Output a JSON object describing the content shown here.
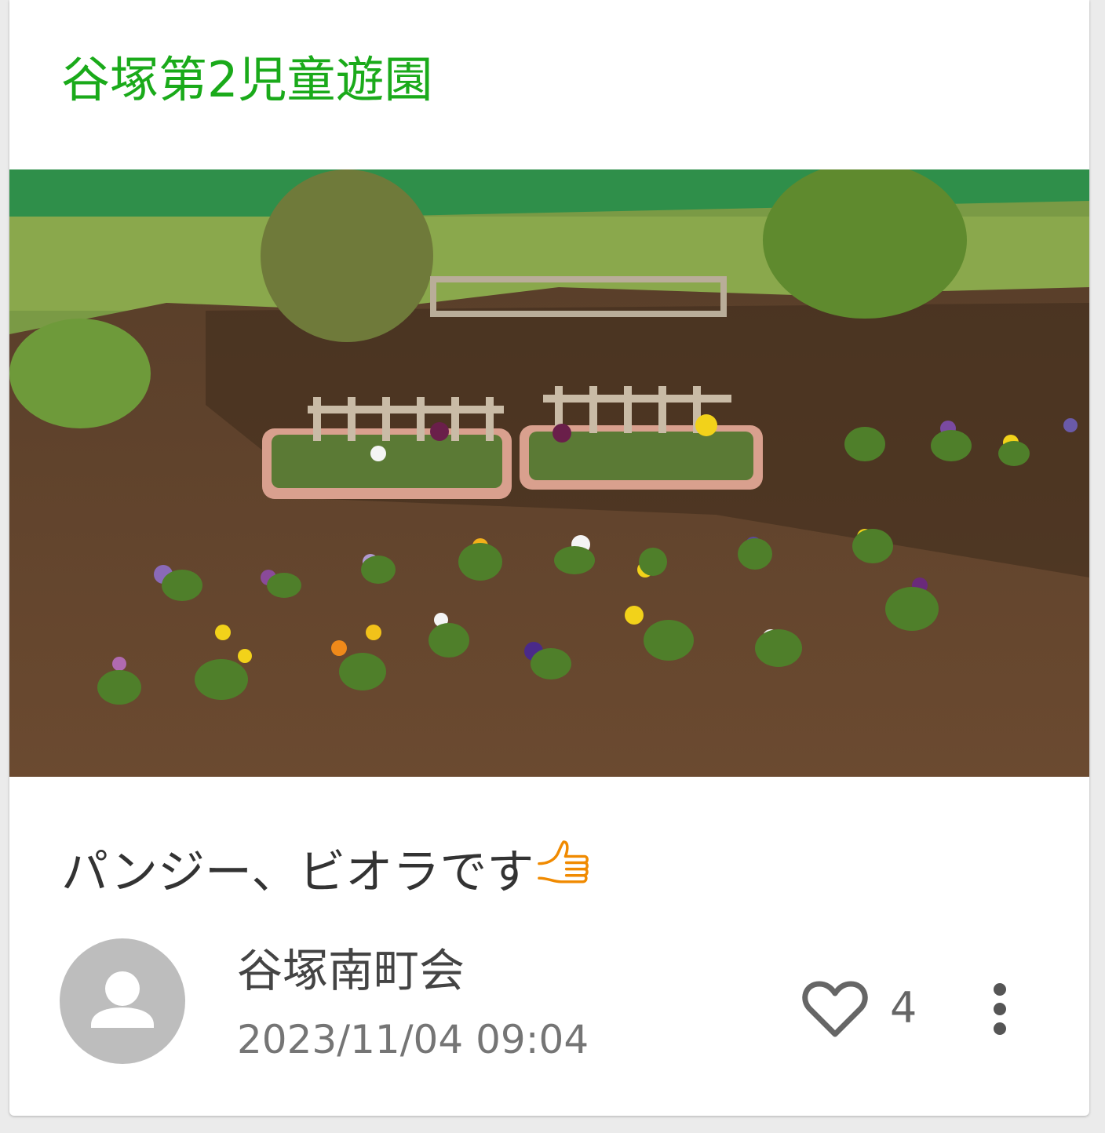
{
  "post": {
    "place_name": "谷塚第2児童遊園",
    "text": "パンジー、ビオラです",
    "text_emoji_icon": "thumbs-up-icon",
    "author": "谷塚南町会",
    "timestamp": "2023/11/04 09:04",
    "like_count": "4"
  },
  "colors": {
    "title_green": "#1aaa1a",
    "emoji_orange": "#f08a00",
    "icon_gray": "#666666",
    "avatar_gray": "#bdbdbd"
  }
}
